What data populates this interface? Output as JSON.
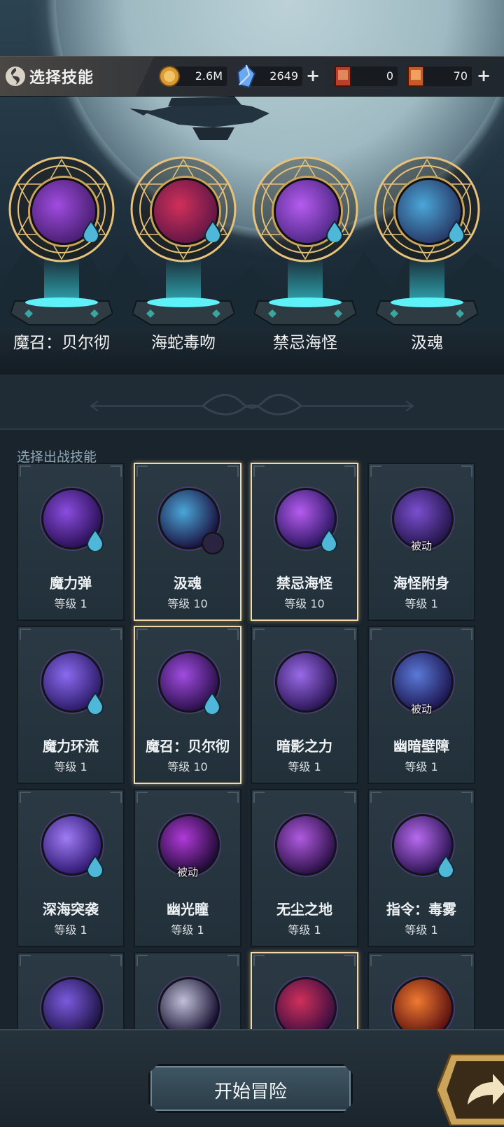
{
  "header": {
    "title": "选择技能",
    "coins": "2.6M",
    "crystals": "2649",
    "ticket_red": "0",
    "ticket_orange": "70"
  },
  "selected_slots": [
    {
      "name": "魔召：贝尔彻",
      "icon": "sea-monster-icon"
    },
    {
      "name": "海蛇毒吻",
      "icon": "serpent-maw-icon"
    },
    {
      "name": "禁忌海怪",
      "icon": "forbidden-monster-icon"
    },
    {
      "name": "汲魂",
      "icon": "soul-drain-icon"
    }
  ],
  "section_title": "选择出战技能",
  "cards": [
    {
      "name": "魔力弹",
      "level": "等级 1",
      "selected": false,
      "badge": "drop",
      "passive": "",
      "icon": "magic-missile-icon",
      "colors": [
        "#8a4de0",
        "#2a0f55"
      ]
    },
    {
      "name": "汲魂",
      "level": "等级 10",
      "selected": true,
      "badge": "moon",
      "passive": "",
      "icon": "soul-drain-icon",
      "colors": [
        "#4aa7d8",
        "#1a1240"
      ]
    },
    {
      "name": "禁忌海怪",
      "level": "等级 10",
      "selected": true,
      "badge": "drop",
      "passive": "",
      "icon": "forbidden-monster-icon",
      "colors": [
        "#b55cf0",
        "#2b1560"
      ]
    },
    {
      "name": "海怪附身",
      "level": "等级 1",
      "selected": false,
      "badge": "",
      "passive": "被动",
      "icon": "possession-icon",
      "colors": [
        "#7a4fd0",
        "#24154a"
      ]
    },
    {
      "name": "魔力环流",
      "level": "等级 1",
      "selected": false,
      "badge": "drop",
      "passive": "",
      "icon": "mana-flow-icon",
      "colors": [
        "#8a6af0",
        "#2b1a66"
      ]
    },
    {
      "name": "魔召：贝尔彻",
      "level": "等级 10",
      "selected": true,
      "badge": "drop",
      "passive": "",
      "icon": "sea-monster-icon",
      "colors": [
        "#a04ce0",
        "#2a0f4a"
      ]
    },
    {
      "name": "暗影之力",
      "level": "等级 1",
      "selected": false,
      "badge": "",
      "passive": "",
      "icon": "shadow-power-icon",
      "colors": [
        "#9a6ae8",
        "#2a1555"
      ]
    },
    {
      "name": "幽暗壁障",
      "level": "等级 1",
      "selected": false,
      "badge": "",
      "passive": "被动",
      "icon": "dark-barrier-icon",
      "colors": [
        "#5a7ad8",
        "#1c1550"
      ]
    },
    {
      "name": "深海突袭",
      "level": "等级 1",
      "selected": false,
      "badge": "drop",
      "passive": "",
      "icon": "deep-sea-strike-icon",
      "colors": [
        "#9f7cf5",
        "#2e1770"
      ]
    },
    {
      "name": "幽光瞳",
      "level": "等级 1",
      "selected": false,
      "badge": "",
      "passive": "被动",
      "icon": "glowing-eye-icon",
      "colors": [
        "#b03ad8",
        "#200a35"
      ]
    },
    {
      "name": "无尘之地",
      "level": "等级 1",
      "selected": false,
      "badge": "",
      "passive": "",
      "icon": "dustless-land-icon",
      "colors": [
        "#b05ae0",
        "#2a0f45"
      ]
    },
    {
      "name": "指令：毒雾",
      "level": "等级 1",
      "selected": false,
      "badge": "drop",
      "passive": "",
      "icon": "poison-mist-icon",
      "colors": [
        "#b86af0",
        "#2a1250"
      ]
    },
    {
      "name": "",
      "level": "",
      "selected": false,
      "badge": "",
      "passive": "",
      "icon": "cube-icon",
      "colors": [
        "#7b5ae0",
        "#1e1445"
      ]
    },
    {
      "name": "",
      "level": "",
      "selected": false,
      "badge": "",
      "passive": "",
      "icon": "dark-orb-icon",
      "colors": [
        "#c0c0d8",
        "#160f30"
      ]
    },
    {
      "name": "",
      "level": "",
      "selected": true,
      "badge": "",
      "passive": "",
      "icon": "serpent-maw-icon",
      "colors": [
        "#d0305a",
        "#3a0d40"
      ]
    },
    {
      "name": "",
      "level": "",
      "selected": false,
      "badge": "",
      "passive": "",
      "icon": "fire-sword-icon",
      "colors": [
        "#f07a30",
        "#5a1010"
      ]
    }
  ],
  "bottom": {
    "start_label": "开始冒险"
  }
}
